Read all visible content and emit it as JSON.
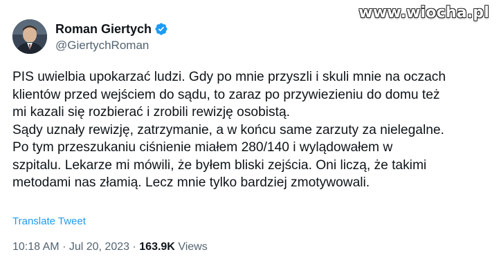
{
  "watermark": "www.wiocha.pl",
  "author": {
    "display_name": "Roman Giertych",
    "handle": "@GiertychRoman",
    "verified": true,
    "verified_color": "#1d9bf0"
  },
  "tweet": {
    "lines": [
      "PIS uwielbia upokarzać ludzi. Gdy po mnie przyszli i skuli mnie na oczach",
      "klientów przed wejściem do sądu, to zaraz po przywiezieniu do domu też",
      "mi kazali się rozbierać i zrobili rewizję osobistą.",
      "Sądy uznały rewizję, zatrzymanie, a w końcu same zarzuty za nielegalne.",
      "Po tym przeszukaniu ciśnienie miałem 280/140 i wylądowałem w",
      "szpitalu. Lekarze mi mówili, że byłem bliski zejścia. Oni liczą, że takimi",
      "metodami nas złamią. Lecz mnie tylko bardziej zmotywowali."
    ],
    "translate_label": "Translate Tweet",
    "time": "10:18 AM",
    "separator": "·",
    "date": "Jul 20, 2023",
    "views_count": "163.9K",
    "views_label": "Views"
  }
}
